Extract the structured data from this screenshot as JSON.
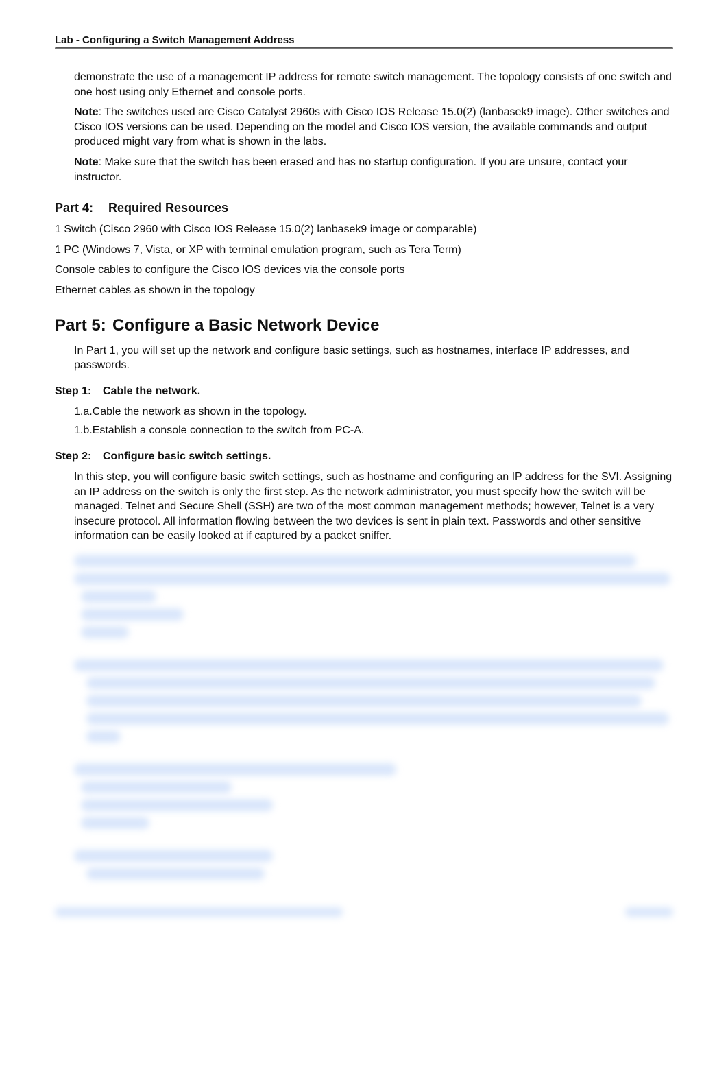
{
  "header": {
    "title": "Lab - Configuring a Switch Management Address"
  },
  "intro": {
    "p1": "demonstrate the use of a management IP address for remote switch management. The topology consists of one switch and one host using only Ethernet and console ports.",
    "note1_label": "Note",
    "note1_body": ": The switches used are Cisco Catalyst 2960s with Cisco IOS Release 15.0(2) (lanbasek9 image). Other switches and Cisco IOS versions can be used. Depending on the model and Cisco IOS version, the available commands and output produced might vary from what is shown in the labs.",
    "note2_label": "Note",
    "note2_body": ": Make sure that the switch has been erased and has no startup configuration. If you are unsure, contact your instructor."
  },
  "part4": {
    "num": "Part 4:",
    "title": "Required Resources",
    "items": [
      "1 Switch (Cisco 2960 with Cisco IOS Release 15.0(2) lanbasek9 image or comparable)",
      "1 PC (Windows 7, Vista, or XP with terminal emulation program, such as Tera Term)",
      "Console cables to configure the Cisco IOS devices via the console ports",
      "Ethernet cables as shown in the topology"
    ]
  },
  "part5": {
    "num": "Part 5:",
    "title": "Configure a Basic Network Device",
    "intro": "In Part 1, you will set up the network and configure basic settings, such as hostnames, interface IP addresses, and passwords.",
    "step1": {
      "num": "Step 1:",
      "title": "Cable the network.",
      "a": "1.a.Cable the network as shown in the topology.",
      "b": "1.b.Establish a console connection to the switch from PC-A."
    },
    "step2": {
      "num": "Step 2:",
      "title": "Configure basic switch settings.",
      "body": "In this step, you will configure basic switch settings, such as hostname and configuring an IP address for the SVI. Assigning an IP address on the switch is only the first step. As the network administrator, you must specify how the switch will be managed. Telnet and Secure Shell (SSH) are two of the most common management methods; however, Telnet is a very insecure protocol. All information flowing between the two devices is sent in plain text. Passwords and other sensitive information can be easily looked at if captured by a packet sniffer."
    }
  }
}
